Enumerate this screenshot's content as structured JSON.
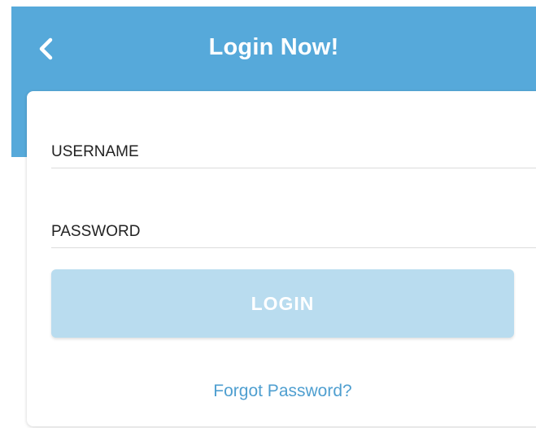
{
  "header": {
    "title": "Login Now!",
    "back_icon": "chevron-left-icon",
    "background_color": "#56a9da"
  },
  "form": {
    "username": {
      "placeholder": "USERNAME",
      "value": ""
    },
    "password": {
      "placeholder": "PASSWORD",
      "value": ""
    },
    "login_label": "LOGIN",
    "login_button_color": "#b9dcef",
    "forgot_password_label": "Forgot Password?",
    "link_color": "#4f9fd0"
  }
}
